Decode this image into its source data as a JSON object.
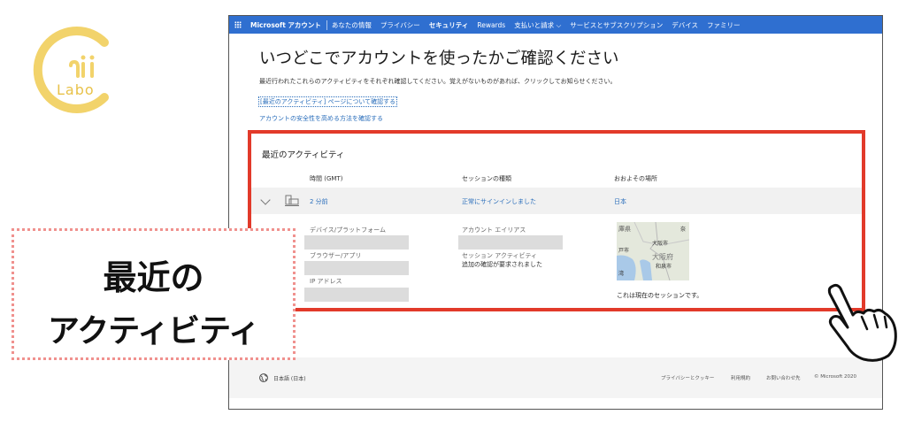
{
  "logo": {
    "text": "Labo"
  },
  "nav": {
    "brand": "Microsoft アカウント",
    "items": [
      {
        "label": "あなたの情報",
        "bold": false
      },
      {
        "label": "プライバシー",
        "bold": false
      },
      {
        "label": "セキュリティ",
        "bold": true
      },
      {
        "label": "Rewards",
        "bold": false
      },
      {
        "label": "支払いと請求 ⌵",
        "bold": false
      },
      {
        "label": "サービスとサブスクリプション",
        "bold": false
      },
      {
        "label": "デバイス",
        "bold": false
      },
      {
        "label": "ファミリー",
        "bold": false
      }
    ]
  },
  "page": {
    "title": "いつどこでアカウントを使ったかご確認ください",
    "description": "最近行われたこれらのアクティビティをそれぞれ確認してください。覚えがないものがあれば、クリックしてお知らせください。",
    "link_recent": "[最近のアクティビティ] ページについて確認する",
    "link_security": "アカウントの安全性を高める方法を確認する"
  },
  "activity": {
    "title": "最近のアクティビティ",
    "headers": {
      "time": "時間 (GMT)",
      "session_type": "セッションの種類",
      "location": "おおよその場所"
    },
    "row": {
      "time": "2 分前",
      "session": "正常にサインインしました",
      "location": "日本"
    },
    "details": {
      "device_label": "デバイス/プラットフォーム",
      "browser_label": "ブラウザー/アプリ",
      "ip_label": "IP アドレス",
      "account_alias_label": "アカウント エイリアス",
      "session_activity_label": "セッション アクティビティ",
      "session_activity_value": "追加の確認が要求されました",
      "current_session": "これは現在のセッションです。"
    },
    "map_labels": {
      "hyogo": "庫県",
      "osaka_city": "大阪市",
      "osaka_pref": "大阪府",
      "izumi": "和泉市",
      "kobe": "戸市",
      "bay": "湾",
      "nara": "奈"
    }
  },
  "footer": {
    "language": "日本語 (日本)",
    "links": [
      "プライバシーとクッキー",
      "利用規約",
      "お問い合わせ先",
      "© Microsoft 2020"
    ]
  },
  "callout": {
    "line1": "最近の",
    "line2": "アクティビティ"
  },
  "colors": {
    "nav_blue": "#2f6fd0",
    "highlight_red": "#e23a2a",
    "link_blue": "#2a6ebb",
    "logo_yellow": "#e8c24a",
    "callout_border": "#f0918e"
  }
}
